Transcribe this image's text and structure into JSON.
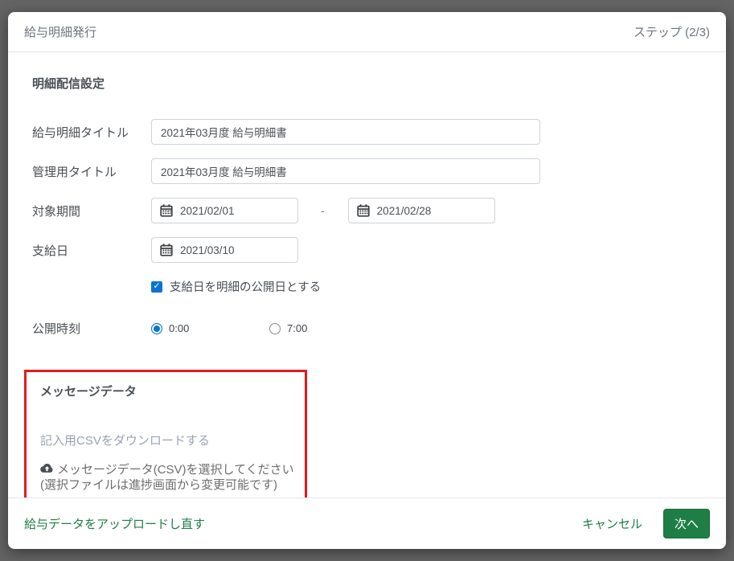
{
  "header": {
    "title": "給与明細発行",
    "step": "ステップ (2/3)"
  },
  "section": {
    "title": "明細配信設定"
  },
  "form": {
    "payslip_title": {
      "label": "給与明細タイトル",
      "value": "2021年03月度 給与明細書"
    },
    "admin_title": {
      "label": "管理用タイトル",
      "value": "2021年03月度 給与明細書"
    },
    "target_period": {
      "label": "対象期間",
      "start": "2021/02/01",
      "separator": "-",
      "end": "2021/02/28"
    },
    "payment_date": {
      "label": "支給日",
      "value": "2021/03/10"
    },
    "publish_checkbox": {
      "label": "支給日を明細の公開日とする",
      "checked": true
    },
    "publish_time": {
      "label": "公開時刻",
      "options": [
        {
          "label": "0:00",
          "selected": true
        },
        {
          "label": "7:00",
          "selected": false
        }
      ]
    }
  },
  "message_data": {
    "title": "メッセージデータ",
    "download_link": "記入用CSVをダウンロードする",
    "upload_line1": "メッセージデータ(CSV)を選択してください",
    "upload_line2": "(選択ファイルは進捗画面から変更可能です)"
  },
  "footer": {
    "reupload_link": "給与データをアップロードし直す",
    "cancel_label": "キャンセル",
    "next_label": "次へ"
  },
  "icons": {
    "calendar": "calendar-icon",
    "upload": "cloud-upload-icon",
    "checkmark": "✓"
  },
  "colors": {
    "accent_green": "#1e7e46",
    "control_blue": "#0b74d1",
    "highlight_red": "#e21b1b",
    "backdrop": "#646464"
  }
}
